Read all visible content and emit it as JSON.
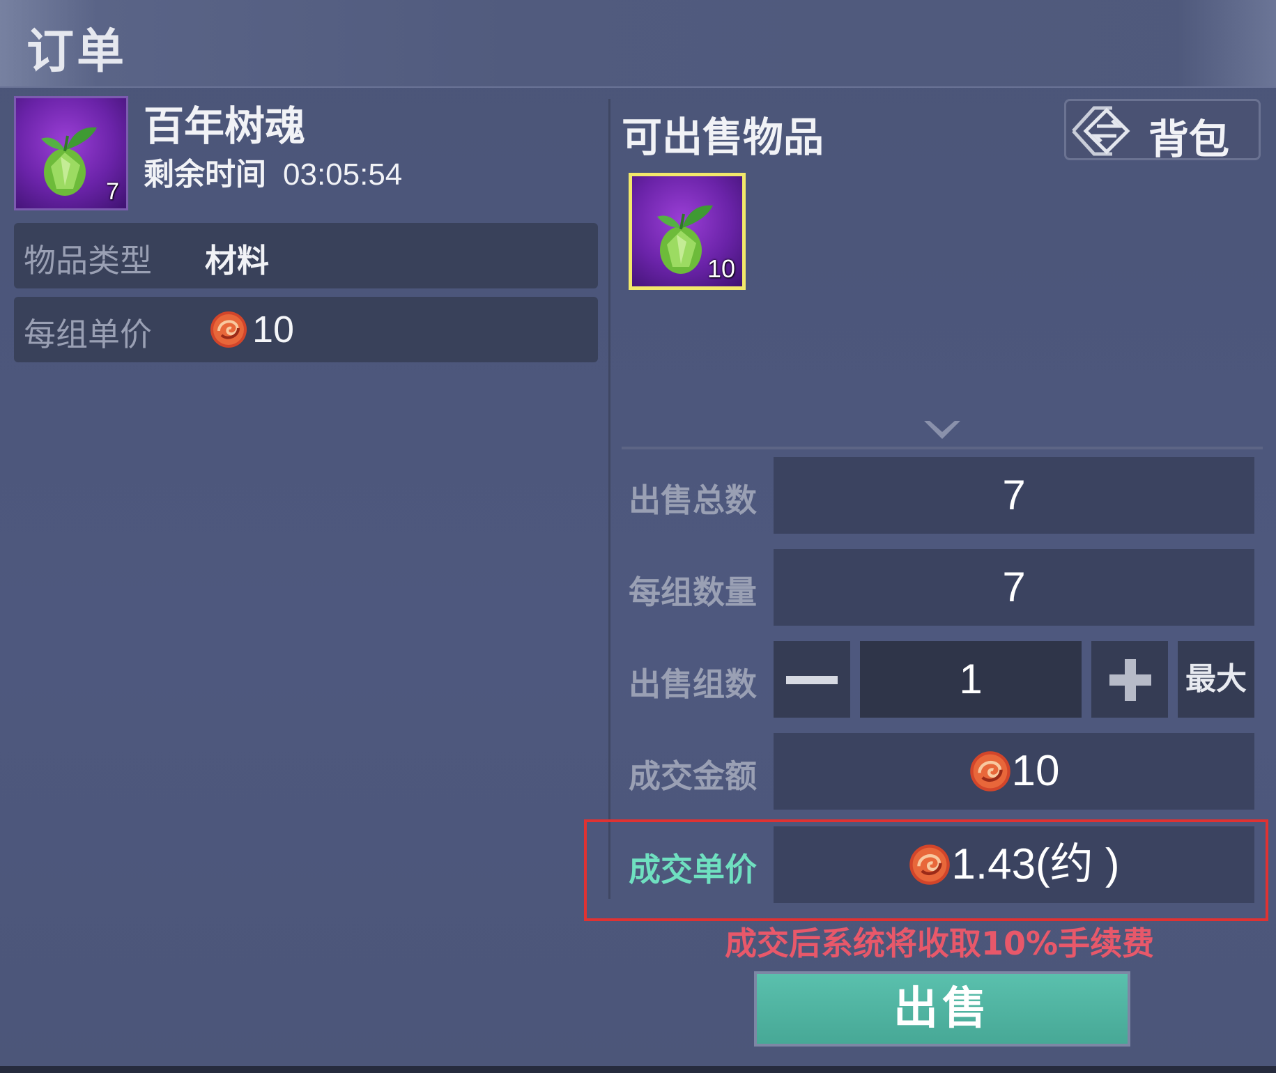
{
  "header": {
    "title": "订单"
  },
  "order_item": {
    "name": "百年树魂",
    "count": "7",
    "remain_label": "剩余时间",
    "remain_time": "03:05:54",
    "type_label": "物品类型",
    "type_value": "材料",
    "unit_price_label": "每组单价",
    "unit_price_value": "10"
  },
  "sellable": {
    "title": "可出售物品",
    "bag_label": "背包",
    "slot_count": "10"
  },
  "form": {
    "total_label": "出售总数",
    "total_value": "7",
    "per_group_label": "每组数量",
    "per_group_value": "7",
    "groups_label": "出售组数",
    "groups_value": "1",
    "max_label": "最大",
    "amount_label": "成交金额",
    "amount_value": "10",
    "deal_unit_label": "成交单价",
    "deal_unit_value": "1.43(约 )"
  },
  "fee_note": "成交后系统将收取10%手续费",
  "sell_button": "出售",
  "colors": {
    "accent_teal": "#5ac0ad",
    "fee_red": "#e8586a",
    "highlight_red": "#e03232",
    "slot_yellow": "#f2e86a",
    "deal_label_teal": "#6fe0c0"
  },
  "icons": [
    "tree-soul-item-icon",
    "coin-icon",
    "swap-arrows-icon",
    "chevron-down-icon",
    "minus-icon",
    "plus-icon"
  ]
}
